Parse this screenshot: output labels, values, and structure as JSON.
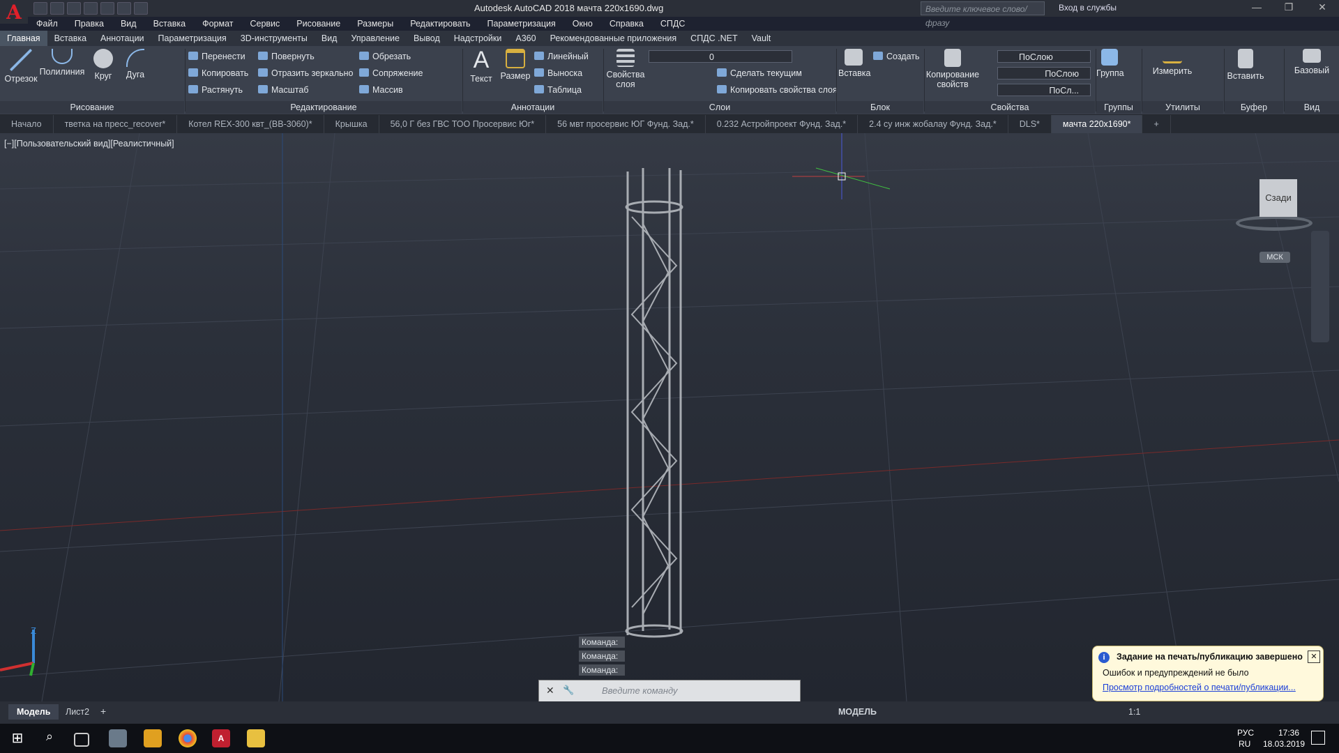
{
  "titlebar": {
    "logo": "A",
    "title": "Autodesk AutoCAD 2018    мачта 220x1690.dwg",
    "search_placeholder": "Введите ключевое слово/фразу",
    "signin": "Вход в службы"
  },
  "menu": [
    "Файл",
    "Правка",
    "Вид",
    "Вставка",
    "Формат",
    "Сервис",
    "Рисование",
    "Размеры",
    "Редактировать",
    "Параметризация",
    "Окно",
    "Справка",
    "СПДС"
  ],
  "ribbon_tabs": [
    "Главная",
    "Вставка",
    "Аннотации",
    "Параметризация",
    "3D-инструменты",
    "Вид",
    "Управление",
    "Вывод",
    "Надстройки",
    "A360",
    "Рекомендованные приложения",
    "СПДС .NET",
    "Vault"
  ],
  "ribbon": {
    "draw": {
      "title": "Рисование",
      "line": "Отрезок",
      "polyline": "Полилиния",
      "circle": "Круг",
      "arc": "Дуга"
    },
    "modify": {
      "title": "Редактирование",
      "move": "Перенести",
      "rotate": "Повернуть",
      "trim": "Обрезать",
      "copy": "Копировать",
      "mirror": "Отразить зеркально",
      "fillet": "Сопряжение",
      "stretch": "Растянуть",
      "scale": "Масштаб",
      "array": "Массив"
    },
    "annotation": {
      "title": "Аннотации",
      "text": "Текст",
      "dimension": "Размер",
      "linear": "Линейный",
      "leader": "Выноска",
      "table": "Таблица"
    },
    "layers": {
      "title": "Слои",
      "properties": "Свойства слоя",
      "current_layer": "0",
      "make_current": "Сделать текущим",
      "match_layer": "Копировать свойства слоя"
    },
    "block": {
      "title": "Блок",
      "insert": "Вставка",
      "create": "Создать"
    },
    "properties": {
      "title": "Свойства",
      "match": "Копирование свойств",
      "color": "ПоСлою",
      "linetype": "ПоСлою",
      "lineweight": "ПоСл..."
    },
    "groups": {
      "title": "Группы",
      "group": "Группа"
    },
    "utilities": {
      "title": "Утилиты",
      "measure": "Измерить"
    },
    "clipboard": {
      "title": "Буфер обмена",
      "paste": "Вставить"
    },
    "view": {
      "title": "Вид",
      "base": "Базовый"
    }
  },
  "doc_tabs": [
    "Начало",
    "тветка на пресс_recover*",
    "Котел REX-300 квт_(BB-3060)*",
    "Крышка",
    "56,0 Г без ГВС ТОО Просервис Юг*",
    "56 мвт просервис ЮГ Фунд. Зад.*",
    "0.232 Астройпроект Фунд. Зад.*",
    "2.4 су инж жобалау  Фунд. Зад.*",
    "DLS*",
    "мачта 220x1690*"
  ],
  "viewport": {
    "label": "[−][Пользовательский вид][Реалистичный]",
    "viewcube_face": "Сзади",
    "ucs_label": "МСК",
    "axis_z": "Z"
  },
  "command": {
    "history": [
      "Команда:",
      "Команда:",
      "Команда:"
    ],
    "placeholder": "Введите команду"
  },
  "notification": {
    "title": "Задание на печать/публикацию завершено",
    "body": "Ошибок и предупреждений не было",
    "link": "Просмотр подробностей о печати/публикации..."
  },
  "status": {
    "layout_tabs": [
      "Модель",
      "Лист2"
    ],
    "model": "МОДЕЛЬ",
    "scale": "1:1"
  },
  "taskbar": {
    "lang": "РУС",
    "lang2": "RU",
    "time": "17:36",
    "date": "18.03.2019"
  }
}
